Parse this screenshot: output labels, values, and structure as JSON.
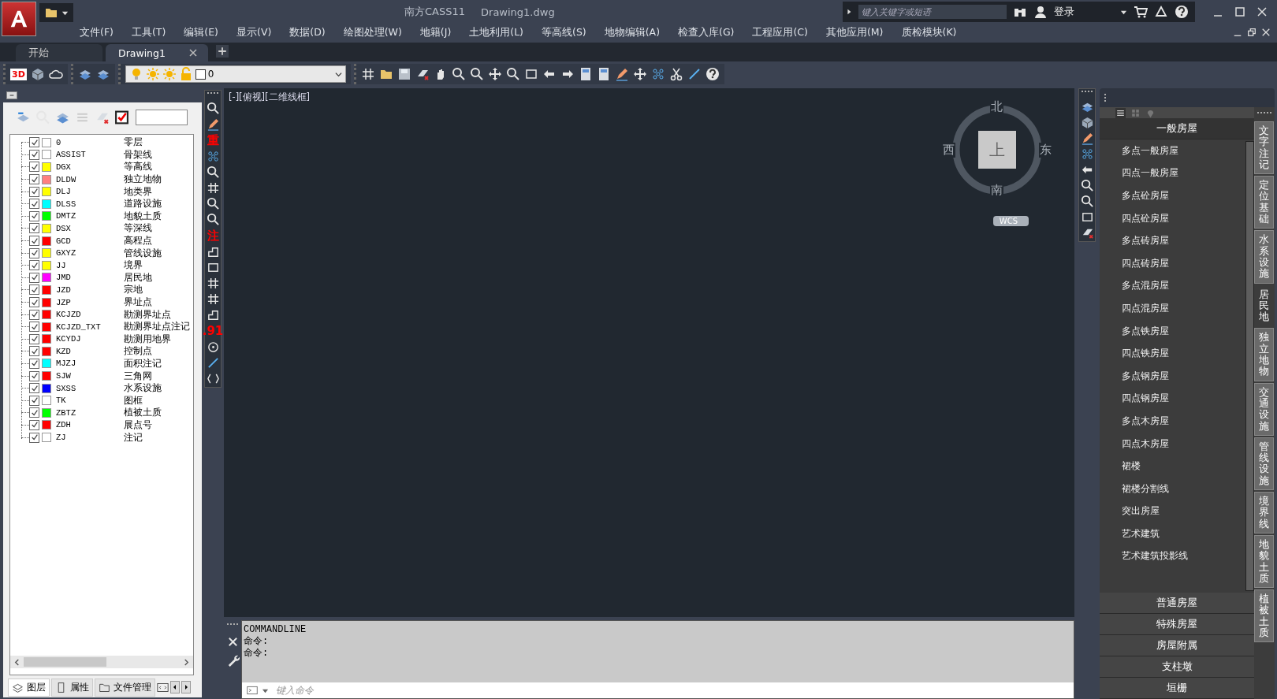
{
  "title": "南方CASS11",
  "file": "Drawing1.dwg",
  "search": {
    "placeholder": "键入关键字或短语"
  },
  "login": "登录",
  "menu": [
    "文件(F)",
    "工具(T)",
    "编辑(E)",
    "显示(V)",
    "数据(D)",
    "绘图处理(W)",
    "地籍(J)",
    "土地利用(L)",
    "等高线(S)",
    "地物编辑(A)",
    "检查入库(G)",
    "工程应用(C)",
    "其他应用(M)",
    "质检模块(K)"
  ],
  "doc_tabs": [
    {
      "label": "开始",
      "selected": false
    },
    {
      "label": "Drawing1",
      "selected": true
    }
  ],
  "view_3d_label": "3D",
  "layer_combo": {
    "value": "0"
  },
  "layers": [
    {
      "name": "0",
      "desc": "零层",
      "visible": true,
      "color": "#ffffff"
    },
    {
      "name": "ASSIST",
      "desc": "骨架线",
      "visible": true,
      "color": "#ffffff"
    },
    {
      "name": "DGX",
      "desc": "等高线",
      "visible": true,
      "color": "#ffff00"
    },
    {
      "name": "DLDW",
      "desc": "独立地物",
      "visible": true,
      "color": "#ff8080"
    },
    {
      "name": "DLJ",
      "desc": "地类界",
      "visible": true,
      "color": "#ffff00"
    },
    {
      "name": "DLSS",
      "desc": "道路设施",
      "visible": true,
      "color": "#00ffff"
    },
    {
      "name": "DMTZ",
      "desc": "地貌土质",
      "visible": true,
      "color": "#00ff00"
    },
    {
      "name": "DSX",
      "desc": "等深线",
      "visible": true,
      "color": "#ffff00"
    },
    {
      "name": "GCD",
      "desc": "高程点",
      "visible": true,
      "color": "#ff0000"
    },
    {
      "name": "GXYZ",
      "desc": "管线设施",
      "visible": true,
      "color": "#ffff00"
    },
    {
      "name": "JJ",
      "desc": "境界",
      "visible": true,
      "color": "#ffff00"
    },
    {
      "name": "JMD",
      "desc": "居民地",
      "visible": true,
      "color": "#ff00ff"
    },
    {
      "name": "JZD",
      "desc": "宗地",
      "visible": true,
      "color": "#ff0000"
    },
    {
      "name": "JZP",
      "desc": "界址点",
      "visible": true,
      "color": "#ff0000"
    },
    {
      "name": "KCJZD",
      "desc": "勘测界址点",
      "visible": true,
      "color": "#ff0000"
    },
    {
      "name": "KCJZD_TXT",
      "desc": "勘测界址点注记",
      "visible": true,
      "color": "#ff0000"
    },
    {
      "name": "KCYDJ",
      "desc": "勘测用地界",
      "visible": true,
      "color": "#ff0000"
    },
    {
      "name": "KZD",
      "desc": "控制点",
      "visible": true,
      "color": "#ff0000"
    },
    {
      "name": "MJZJ",
      "desc": "面积注记",
      "visible": true,
      "color": "#00ffff"
    },
    {
      "name": "SJW",
      "desc": "三角网",
      "visible": true,
      "color": "#ff0000"
    },
    {
      "name": "SXSS",
      "desc": "水系设施",
      "visible": true,
      "color": "#0000ff"
    },
    {
      "name": "TK",
      "desc": "图框",
      "visible": true,
      "color": "#ffffff"
    },
    {
      "name": "ZBTZ",
      "desc": "植被土质",
      "visible": true,
      "color": "#00ff00"
    },
    {
      "name": "ZDH",
      "desc": "展点号",
      "visible": true,
      "color": "#ff0000"
    },
    {
      "name": "ZJ",
      "desc": "注记",
      "visible": true,
      "color": "#ffffff"
    }
  ],
  "left_tabs": [
    {
      "label": "图层",
      "selected": true
    },
    {
      "label": "属性",
      "selected": false
    },
    {
      "label": "文件管理",
      "selected": false
    }
  ],
  "tool_glyphs": [
    "重",
    "注",
    ".91"
  ],
  "canvas": {
    "view_label": "[-][俯视][二维线框]"
  },
  "viewcube": {
    "north": "北",
    "south": "南",
    "east": "东",
    "west": "西",
    "face": "上",
    "wcs": "WCS"
  },
  "command": {
    "history": [
      "COMMANDLINE",
      "命令:",
      "命令:"
    ],
    "placeholder": "键入命令"
  },
  "palette": {
    "sections": [
      {
        "label": "一般房屋",
        "expanded": true,
        "items": [
          "多点一般房屋",
          "四点一般房屋",
          "多点砼房屋",
          "四点砼房屋",
          "多点砖房屋",
          "四点砖房屋",
          "多点混房屋",
          "四点混房屋",
          "多点铁房屋",
          "四点铁房屋",
          "多点钢房屋",
          "四点钢房屋",
          "多点木房屋",
          "四点木房屋",
          "裙楼",
          "裙楼分割线",
          "突出房屋",
          "艺术建筑",
          "艺术建筑投影线"
        ]
      },
      {
        "label": "普通房屋",
        "expanded": false
      },
      {
        "label": "特殊房屋",
        "expanded": false
      },
      {
        "label": "房屋附属",
        "expanded": false
      },
      {
        "label": "支柱墩",
        "expanded": false
      },
      {
        "label": "垣栅",
        "expanded": false
      }
    ]
  },
  "side_tabs": [
    {
      "label": "文字注记",
      "selected": false
    },
    {
      "label": "定位基础",
      "selected": false
    },
    {
      "label": "水系设施",
      "selected": false
    },
    {
      "label": "居民地",
      "selected": true
    },
    {
      "label": "独立地物",
      "selected": false
    },
    {
      "label": "交通设施",
      "selected": false
    },
    {
      "label": "管线设施",
      "selected": false
    },
    {
      "label": "境界线",
      "selected": false
    },
    {
      "label": "地貌土质",
      "selected": false
    },
    {
      "label": "植被土质",
      "selected": false
    }
  ]
}
